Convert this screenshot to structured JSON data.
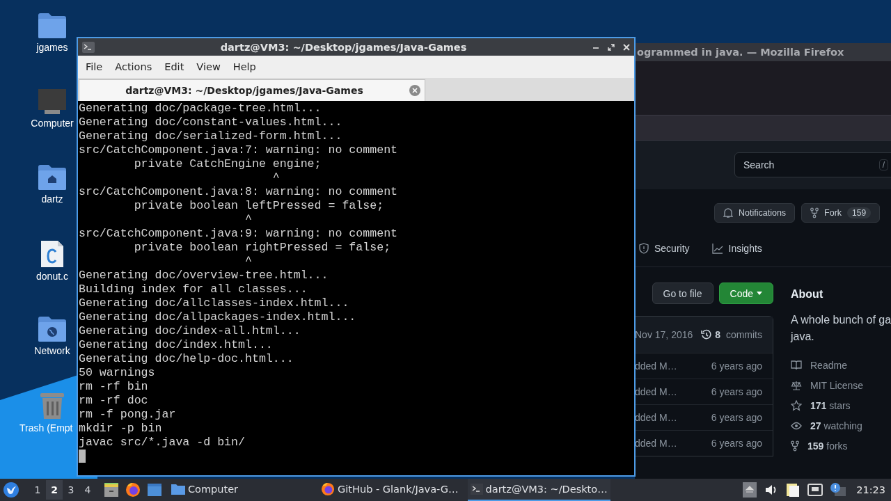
{
  "desktop_icons": [
    {
      "label": "jgames",
      "kind": "folder"
    },
    {
      "label": "Computer",
      "kind": "computer"
    },
    {
      "label": "dartz",
      "kind": "home"
    },
    {
      "label": "donut.c",
      "kind": "file"
    },
    {
      "label": "Network",
      "kind": "network"
    },
    {
      "label": "Trash (Empt",
      "kind": "trash"
    }
  ],
  "browser_window": {
    "title": "ogrammed in java. — Mozilla Firefox",
    "search": {
      "placeholder": "Search",
      "shortcut": "/"
    },
    "repo_buttons": [
      {
        "label": "Notifications",
        "kind": "notifications"
      },
      {
        "label": "Fork",
        "count": "159",
        "kind": "fork"
      }
    ],
    "repo_tabs": [
      {
        "label": "Security",
        "kind": "security"
      },
      {
        "label": "Insights",
        "kind": "insights"
      }
    ],
    "file_actions": [
      {
        "label": "Go to file",
        "kind": "plain"
      },
      {
        "label": "Code",
        "kind": "primary"
      }
    ],
    "commit_header": {
      "date": "Nov 17, 2016",
      "commit_count": "8",
      "commit_label": "commits"
    },
    "file_rows": [
      {
        "message": "dded M…",
        "age": "6 years ago"
      },
      {
        "message": "dded M…",
        "age": "6 years ago"
      },
      {
        "message": "dded M…",
        "age": "6 years ago"
      },
      {
        "message": "dded M…",
        "age": "6 years ago"
      }
    ],
    "about": {
      "title": "About",
      "description": [
        "A whole bunch of ga",
        "java."
      ],
      "links": [
        {
          "kind": "readme",
          "text": "Readme"
        },
        {
          "kind": "license",
          "text": "MIT License"
        },
        {
          "kind": "stars",
          "count": "171",
          "text": "stars"
        },
        {
          "kind": "watching",
          "count": "27",
          "text": "watching"
        },
        {
          "kind": "forks",
          "count": "159",
          "text": "forks"
        }
      ]
    }
  },
  "terminal_window": {
    "title": "dartz@VM3: ~/Desktop/jgames/Java-Games",
    "menu": [
      "File",
      "Actions",
      "Edit",
      "View",
      "Help"
    ],
    "tab": {
      "title": "dartz@VM3: ~/Desktop/jgames/Java-Games"
    },
    "lines": [
      "Generating doc/package-tree.html...",
      "Generating doc/constant-values.html...",
      "Generating doc/serialized-form.html...",
      "src/CatchComponent.java:7: warning: no comment",
      "        private CatchEngine engine;",
      "                            ^",
      "src/CatchComponent.java:8: warning: no comment",
      "        private boolean leftPressed = false;",
      "                        ^",
      "src/CatchComponent.java:9: warning: no comment",
      "        private boolean rightPressed = false;",
      "                        ^",
      "Generating doc/overview-tree.html...",
      "Building index for all classes...",
      "Generating doc/allclasses-index.html...",
      "Generating doc/allpackages-index.html...",
      "Generating doc/index-all.html...",
      "Generating doc/index.html...",
      "Generating doc/help-doc.html...",
      "50 warnings",
      "rm -rf bin",
      "rm -rf doc",
      "rm -f pong.jar",
      "mkdir -p bin",
      "javac src/*.java -d bin/"
    ]
  },
  "taskbar": {
    "workspaces": [
      {
        "label": "1",
        "selected": false
      },
      {
        "label": "2",
        "selected": true
      },
      {
        "label": "3",
        "selected": false
      },
      {
        "label": "4",
        "selected": false
      }
    ],
    "tasks": [
      {
        "label": "Computer",
        "kind": "folder",
        "active": false
      },
      {
        "label": "GitHub - Glank/Java-G…",
        "kind": "firefox",
        "active": false
      },
      {
        "label": "dartz@VM3: ~/Deskto…",
        "kind": "terminal",
        "active": true
      }
    ],
    "clock": "21:23"
  }
}
